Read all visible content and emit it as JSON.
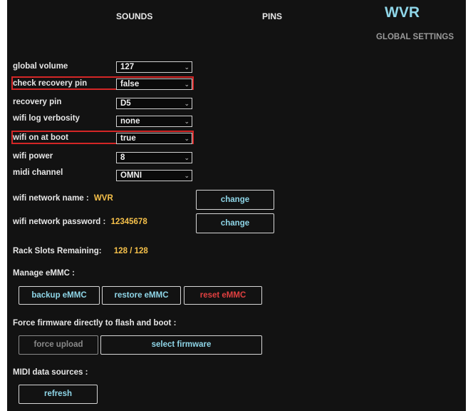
{
  "nav": {
    "tab_sounds": "SOUNDS",
    "tab_pins": "PINS",
    "logo": "WVR",
    "subtab": "GLOBAL SETTINGS"
  },
  "settings": [
    {
      "label": "global volume",
      "value": "127"
    },
    {
      "label": "check recovery pin",
      "value": "false"
    },
    {
      "label": "recovery pin",
      "value": "D5"
    },
    {
      "label": "wifi log verbosity",
      "value": "none"
    },
    {
      "label": "wifi on at boot",
      "value": "true"
    },
    {
      "label": "wifi power",
      "value": "8"
    },
    {
      "label": "midi channel",
      "value": "OMNI"
    }
  ],
  "wifi": {
    "name_label": "wifi network name :",
    "name_value": "WVR",
    "password_label": "wifi network password :",
    "password_value": "12345678",
    "change_label": "change"
  },
  "rack": {
    "label": "Rack Slots Remaining:",
    "value": "128 / 128"
  },
  "emmc": {
    "heading": "Manage eMMC :",
    "backup": "backup eMMC",
    "restore": "restore eMMC",
    "reset": "reset eMMC"
  },
  "firmware": {
    "heading": "Force firmware directly to flash and boot :",
    "force_upload": "force upload",
    "select": "select firmware"
  },
  "midi": {
    "heading": "MIDI data sources :",
    "refresh": "refresh"
  },
  "colors": {
    "accent": "#8fd6e8",
    "value_yellow": "#f5c04a",
    "highlight_red": "#d42626",
    "danger_red": "#e04040",
    "background": "#121212"
  }
}
